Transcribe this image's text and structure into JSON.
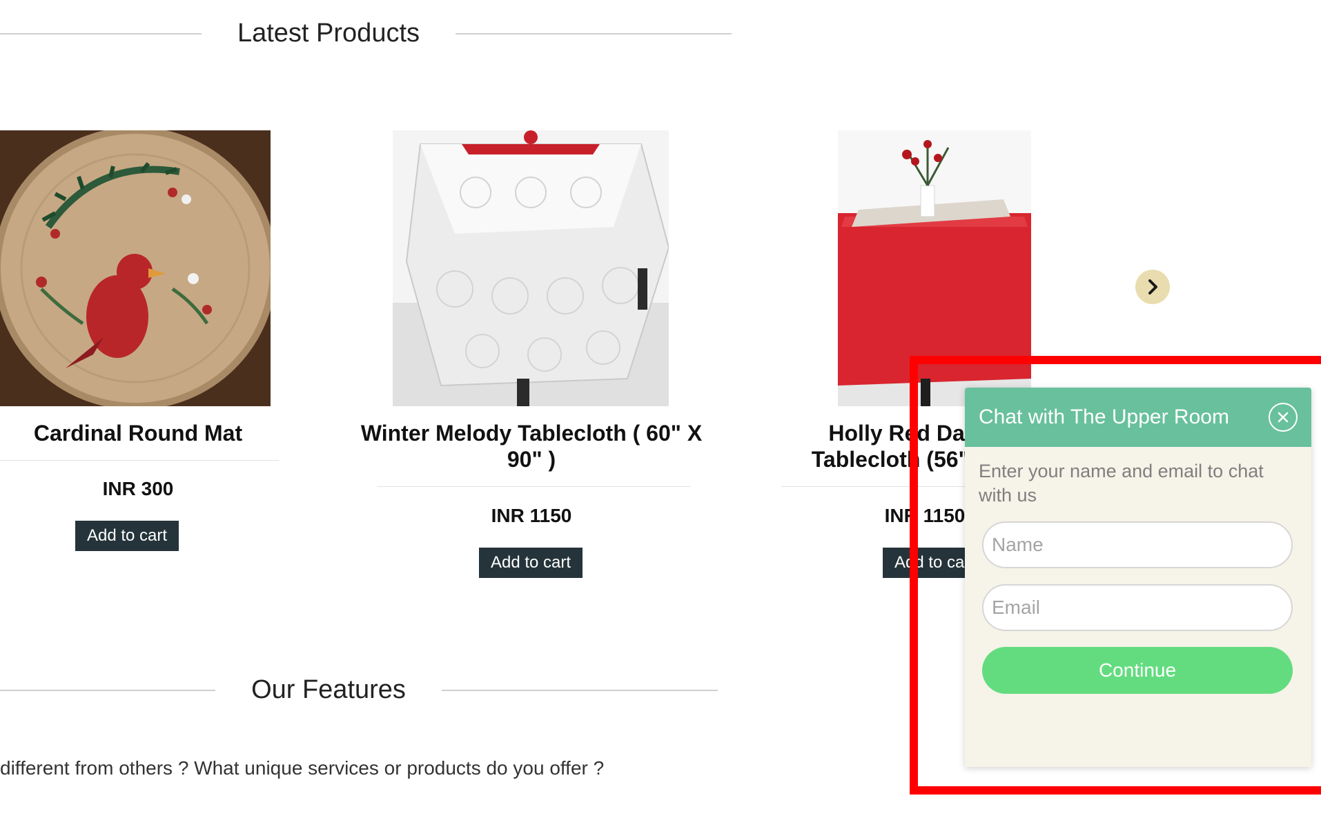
{
  "sections": {
    "latest_products_title": "Latest Products",
    "our_features_title": "Our Features",
    "features_text": "different from others ? What unique services or products do you offer ?"
  },
  "products": [
    {
      "name": "Cardinal Round Mat",
      "price": "INR 300",
      "button_label": "Add to cart"
    },
    {
      "name": "Winter Melody Tablecloth ( 60\" X 90\" )",
      "price": "INR 1150",
      "button_label": "Add to cart"
    },
    {
      "name": "Holly Red Damask Tablecloth (56\" X 90\")",
      "price": "INR 1150",
      "button_label": "Add to cart"
    }
  ],
  "carousel": {
    "next_icon": "chevron-right-icon"
  },
  "chat": {
    "title": "Chat with The Upper Room",
    "close_icon": "close-icon",
    "prompt": "Enter your name and email to chat with us",
    "name_placeholder": "Name",
    "email_placeholder": "Email",
    "continue_label": "Continue"
  },
  "colors": {
    "chat_header": "#68c09d",
    "chat_body": "#f6f3e8",
    "continue_button": "#63dc7f",
    "cart_button": "#25343a",
    "carousel_button": "#e9dcae",
    "highlight": "#ff0000"
  }
}
